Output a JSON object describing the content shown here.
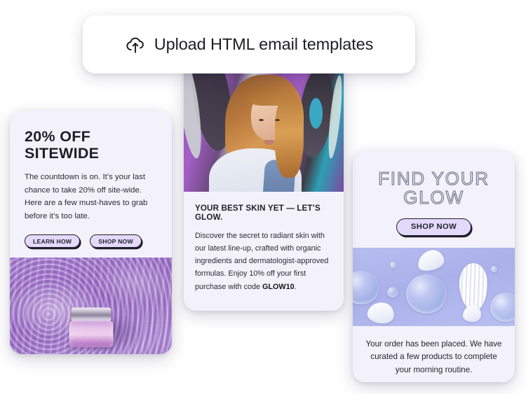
{
  "upload_bar": {
    "icon": "cloud-upload-icon",
    "label": "Upload HTML email templates"
  },
  "cards": {
    "left": {
      "name": "promo-card-sitewide",
      "headline": "20% OFF SITEWIDE",
      "body": "The countdown is on. It’s your last chance to take 20% off site-wide. Here are a few must-haves to grab before it’s too late.",
      "buttons": [
        {
          "label": "LEARN HOW",
          "name": "learn-how-button"
        },
        {
          "label": "SHOP NOW",
          "name": "shop-now-button"
        }
      ],
      "image_alt": "purple cosmetic cream jar floating in rippled lavender water"
    },
    "middle": {
      "name": "promo-card-best-skin",
      "image_alt": "smiling woman with long auburn hair leaning against a purple graffiti wall",
      "headline": "YOUR BEST SKIN YET — LET’S GLOW.",
      "body_before_code": "Discover the secret to radiant skin with our latest line-up, crafted with organic ingredients and dermatologist-approved formulas. Enjoy 10% off your first purchase with code ",
      "promo_code": "GLOW10",
      "body_after_code": "."
    },
    "right": {
      "name": "promo-card-find-your-glow",
      "headline_line1": "FIND YOUR",
      "headline_line2": "GLOW",
      "button": {
        "label": "SHOP NOW",
        "name": "shop-now-button"
      },
      "image_alt": "clear gel droplets and white cream swatches on a periwinkle background",
      "footer_note": "Your order has been placed. We have curated a few products to complete your morning routine."
    }
  },
  "colors": {
    "page_background": "#ffffff",
    "card_background": "#f3f2fb",
    "bar_background": "#ffffff",
    "button_fill": "#e3d9fa",
    "ink": "#1f1f29",
    "outline_headline": "#6e6e82",
    "purple_water": "#9a6bc6",
    "periwinkle": "#b0b7ec"
  }
}
